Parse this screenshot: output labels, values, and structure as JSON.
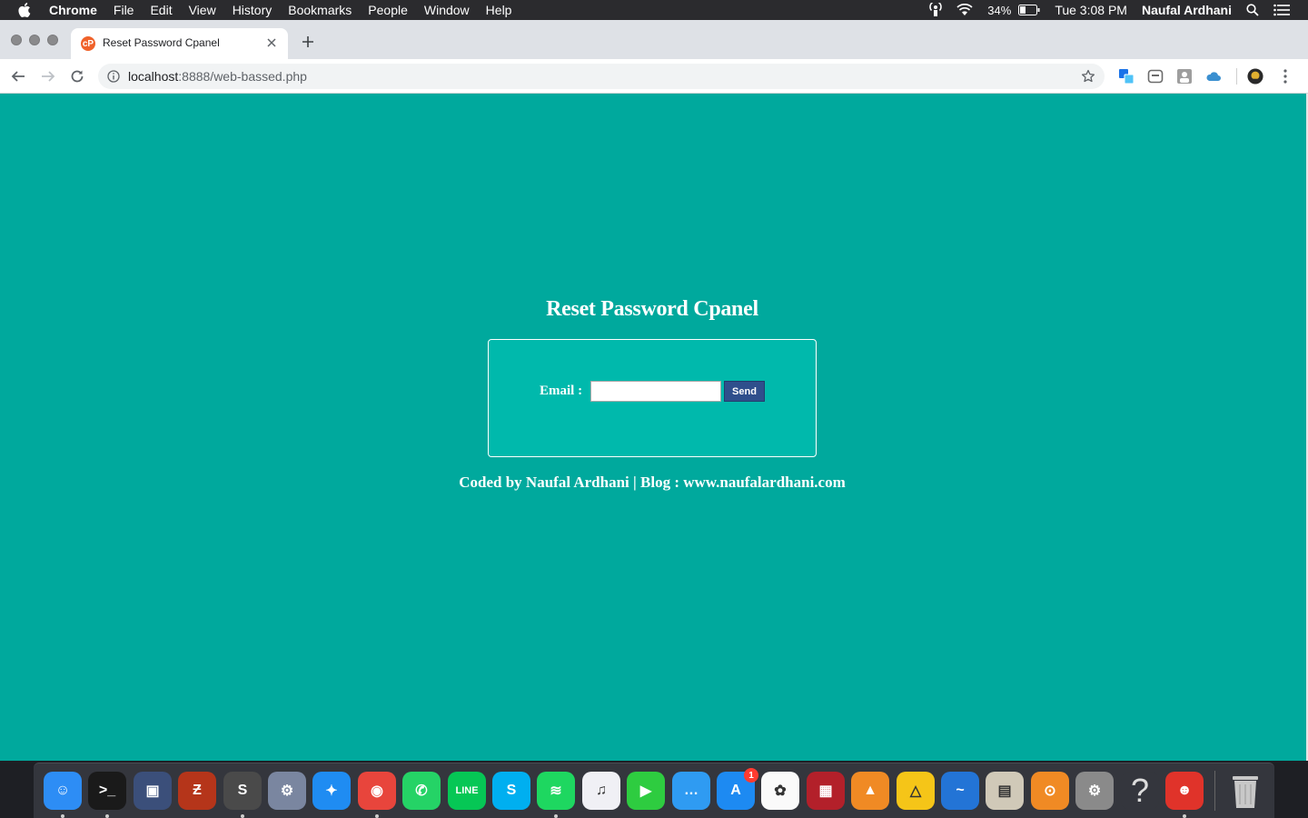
{
  "menubar": {
    "app_name": "Chrome",
    "menus": [
      "File",
      "Edit",
      "View",
      "History",
      "Bookmarks",
      "People",
      "Window",
      "Help"
    ],
    "battery": "34%",
    "clock": "Tue 3:08 PM",
    "user": "Naufal Ardhani"
  },
  "browser": {
    "tab_title": "Reset Password Cpanel",
    "url_host": "localhost",
    "url_rest": ":8888/web-bassed.php"
  },
  "page": {
    "title": "Reset Password Cpanel",
    "email_label": "Email :",
    "email_value": "",
    "send_label": "Send",
    "footer": "Coded by Naufal Ardhani | Blog : www.naufalardhani.com",
    "bg_color": "#00a99d"
  },
  "dock": {
    "apps": [
      {
        "name": "finder-icon",
        "color": "#2d8df5"
      },
      {
        "name": "terminal-icon",
        "color": "#1a1a1a"
      },
      {
        "name": "virtualbox-icon",
        "color": "#3b4f7a"
      },
      {
        "name": "filezilla-icon",
        "color": "#b5351a"
      },
      {
        "name": "sublime-text-icon",
        "color": "#4a4a4a"
      },
      {
        "name": "preferences-app-icon",
        "color": "#7a86a0"
      },
      {
        "name": "safari-icon",
        "color": "#1f8cf2"
      },
      {
        "name": "chrome-icon",
        "color": "#e8453c"
      },
      {
        "name": "whatsapp-icon",
        "color": "#25d366"
      },
      {
        "name": "line-icon",
        "color": "#06c755"
      },
      {
        "name": "skype-icon",
        "color": "#00aff0"
      },
      {
        "name": "spotify-icon",
        "color": "#1ed760"
      },
      {
        "name": "itunes-icon",
        "color": "#f0f0f5"
      },
      {
        "name": "facetime-icon",
        "color": "#2ecc40"
      },
      {
        "name": "messages-icon",
        "color": "#2f9bf2"
      },
      {
        "name": "app-store-icon",
        "color": "#1d8af2"
      },
      {
        "name": "photos-icon",
        "color": "#fafafa"
      },
      {
        "name": "photo-booth-icon",
        "color": "#b3202a"
      },
      {
        "name": "vlc-icon",
        "color": "#f08a24"
      },
      {
        "name": "google-drive-icon",
        "color": "#f5c518"
      },
      {
        "name": "mail-app-icon",
        "color": "#2374d6"
      },
      {
        "name": "calculator-icon",
        "color": "#d0c9b8"
      },
      {
        "name": "vpn-lock-icon",
        "color": "#f08a24"
      },
      {
        "name": "system-preferences-icon",
        "color": "#8a8a8a"
      },
      {
        "name": "help-icon",
        "color": "#34363d"
      },
      {
        "name": "hotspot-shield-icon",
        "color": "#e0332a"
      }
    ],
    "trash": {
      "name": "trash-icon",
      "color": "#c8c8c8"
    },
    "app_store_badge": "1"
  }
}
